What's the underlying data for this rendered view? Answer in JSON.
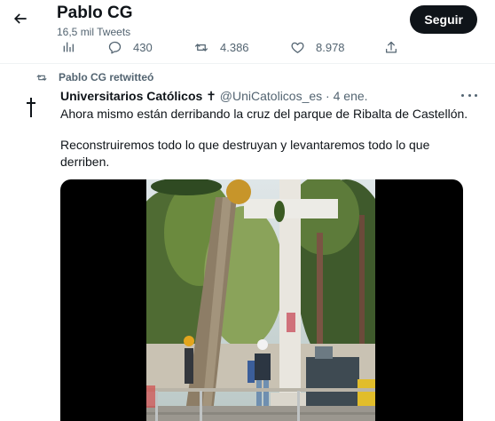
{
  "header": {
    "title": "Pablo CG",
    "subtitle": "16,5 mil Tweets",
    "follow_label": "Seguir",
    "back_icon": "arrow-left-icon"
  },
  "prev_tweet_actions": {
    "analytics_icon": "analytics-icon",
    "replies": "430",
    "retweets": "4.386",
    "likes": "8.978",
    "share_icon": "share-icon"
  },
  "retweet": {
    "label": "Pablo CG retwitteó",
    "author_name": "Universitarios Católicos ✝",
    "author_handle": "@UniCatolicos_es",
    "separator": " · ",
    "date": "4 ene.",
    "text_line1": "Ahora mismo están derribando la cruz del parque de Ribalta de Castellón.",
    "text_line2": "Reconstruiremos todo lo que destruyan y levantaremos todo lo que derriben."
  },
  "colors": {
    "text": "#0f1419",
    "secondary": "#536471",
    "follow_bg": "#0f1419",
    "divider": "#eff3f4"
  }
}
